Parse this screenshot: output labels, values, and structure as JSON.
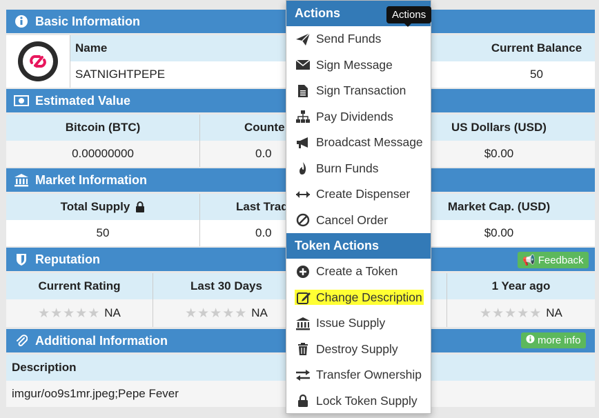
{
  "basic": {
    "title": "Basic Information",
    "name_label": "Name",
    "name_value": "SATNIGHTPEPE",
    "balance_label": "Current Balance",
    "balance_value": "50"
  },
  "estimated": {
    "title": "Estimated Value",
    "btc_label": "Bitcoin (BTC)",
    "btc_value": "0.00000000",
    "counter_label": "Counte",
    "counter_value": "0.0",
    "usd_label": "US Dollars (USD)",
    "usd_value": "$0.00"
  },
  "market": {
    "title": "Market Information",
    "supply_label": "Total Supply",
    "supply_value": "50",
    "last_label": "Last Trad",
    "last_value": "0.0",
    "cap_label": "Market Cap. (USD)",
    "cap_value": "$0.00"
  },
  "reputation": {
    "title": "Reputation",
    "feedback_label": "Feedback",
    "current_label": "Current Rating",
    "current_value": "NA",
    "last30_label": "Last 30 Days",
    "last30_value": "NA",
    "year_label": "1 Year ago",
    "year_value": "NA",
    "stars": "★★★★★"
  },
  "additional": {
    "title": "Additional Information",
    "more_label": "more info",
    "desc_label": "Description",
    "desc_value": "imgur/oo9s1mr.jpeg;Pepe Fever"
  },
  "tooltip": "Actions",
  "menu": {
    "actions_header": "Actions",
    "actions": [
      "Send Funds",
      "Sign Message",
      "Sign Transaction",
      "Pay Dividends",
      "Broadcast Message",
      "Burn Funds",
      "Create Dispenser",
      "Cancel Order"
    ],
    "token_header": "Token Actions",
    "token_actions": [
      "Create a Token",
      "Change Description",
      "Issue Supply",
      "Destroy Supply",
      "Transfer Ownership",
      "Lock Token Supply"
    ]
  },
  "colors": {
    "header": "#428bca",
    "subheader": "#d9edf7",
    "menu_header": "#337ab7",
    "green": "#5cb85c",
    "logo": "#e8175d",
    "highlight": "#ffff33"
  }
}
